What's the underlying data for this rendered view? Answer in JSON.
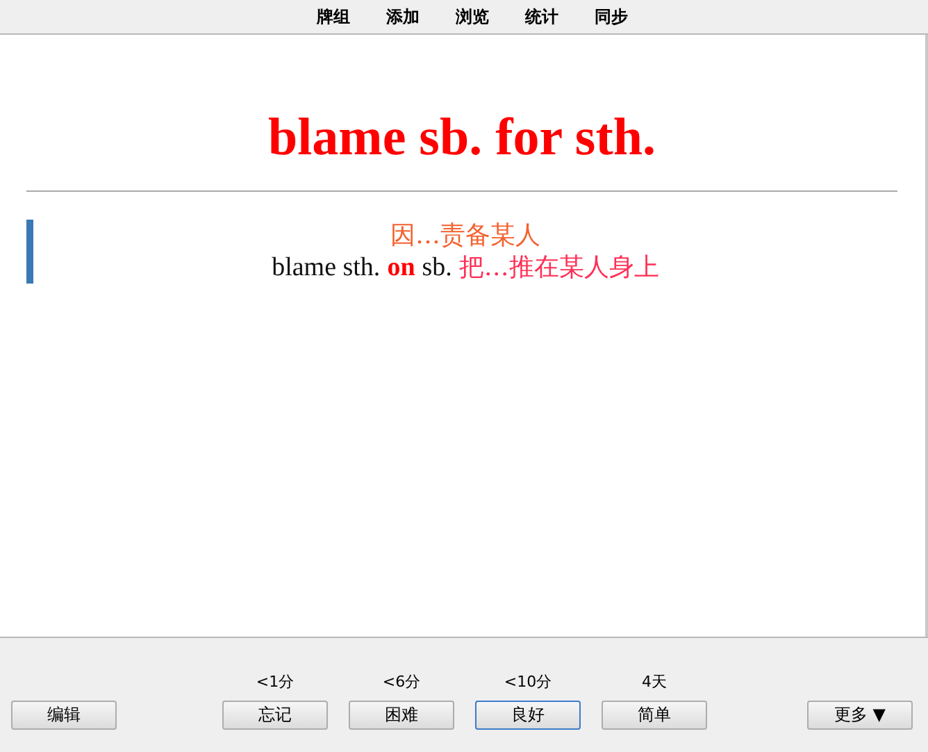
{
  "menu": [
    "牌组",
    "添加",
    "浏览",
    "统计",
    "同步"
  ],
  "card": {
    "front": "blame sb. for sth.",
    "back_lines": [
      [
        {
          "kind": "cn",
          "text": "因…责备某人"
        }
      ],
      [
        {
          "kind": "en",
          "text": "blame sth."
        },
        {
          "kind": "keyword",
          "text": "on"
        },
        {
          "kind": "en",
          "text": "sb."
        },
        {
          "kind": "cn2",
          "text": "把…推在某人身上"
        }
      ]
    ]
  },
  "bottom": {
    "edit": "编辑",
    "more": "更多 ▼",
    "answers": [
      {
        "interval": "<1分",
        "label": "忘记",
        "selected": false
      },
      {
        "interval": "<6分",
        "label": "困难",
        "selected": false
      },
      {
        "interval": "<10分",
        "label": "良好",
        "selected": true
      },
      {
        "interval": "4天",
        "label": "简单",
        "selected": false
      }
    ]
  }
}
